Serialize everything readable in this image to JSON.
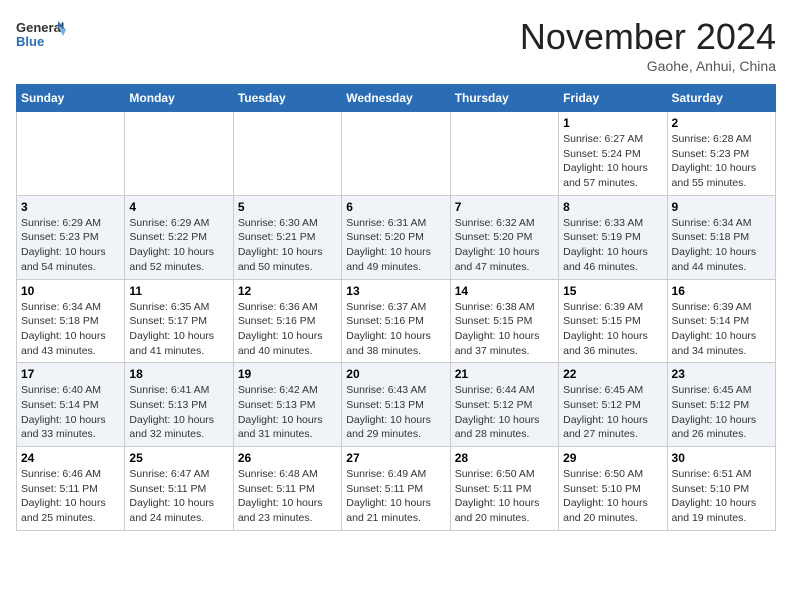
{
  "header": {
    "logo_line1": "General",
    "logo_line2": "Blue",
    "month_title": "November 2024",
    "location": "Gaohe, Anhui, China"
  },
  "weekdays": [
    "Sunday",
    "Monday",
    "Tuesday",
    "Wednesday",
    "Thursday",
    "Friday",
    "Saturday"
  ],
  "weeks": [
    [
      {
        "day": "",
        "info": ""
      },
      {
        "day": "",
        "info": ""
      },
      {
        "day": "",
        "info": ""
      },
      {
        "day": "",
        "info": ""
      },
      {
        "day": "",
        "info": ""
      },
      {
        "day": "1",
        "info": "Sunrise: 6:27 AM\nSunset: 5:24 PM\nDaylight: 10 hours and 57 minutes."
      },
      {
        "day": "2",
        "info": "Sunrise: 6:28 AM\nSunset: 5:23 PM\nDaylight: 10 hours and 55 minutes."
      }
    ],
    [
      {
        "day": "3",
        "info": "Sunrise: 6:29 AM\nSunset: 5:23 PM\nDaylight: 10 hours and 54 minutes."
      },
      {
        "day": "4",
        "info": "Sunrise: 6:29 AM\nSunset: 5:22 PM\nDaylight: 10 hours and 52 minutes."
      },
      {
        "day": "5",
        "info": "Sunrise: 6:30 AM\nSunset: 5:21 PM\nDaylight: 10 hours and 50 minutes."
      },
      {
        "day": "6",
        "info": "Sunrise: 6:31 AM\nSunset: 5:20 PM\nDaylight: 10 hours and 49 minutes."
      },
      {
        "day": "7",
        "info": "Sunrise: 6:32 AM\nSunset: 5:20 PM\nDaylight: 10 hours and 47 minutes."
      },
      {
        "day": "8",
        "info": "Sunrise: 6:33 AM\nSunset: 5:19 PM\nDaylight: 10 hours and 46 minutes."
      },
      {
        "day": "9",
        "info": "Sunrise: 6:34 AM\nSunset: 5:18 PM\nDaylight: 10 hours and 44 minutes."
      }
    ],
    [
      {
        "day": "10",
        "info": "Sunrise: 6:34 AM\nSunset: 5:18 PM\nDaylight: 10 hours and 43 minutes."
      },
      {
        "day": "11",
        "info": "Sunrise: 6:35 AM\nSunset: 5:17 PM\nDaylight: 10 hours and 41 minutes."
      },
      {
        "day": "12",
        "info": "Sunrise: 6:36 AM\nSunset: 5:16 PM\nDaylight: 10 hours and 40 minutes."
      },
      {
        "day": "13",
        "info": "Sunrise: 6:37 AM\nSunset: 5:16 PM\nDaylight: 10 hours and 38 minutes."
      },
      {
        "day": "14",
        "info": "Sunrise: 6:38 AM\nSunset: 5:15 PM\nDaylight: 10 hours and 37 minutes."
      },
      {
        "day": "15",
        "info": "Sunrise: 6:39 AM\nSunset: 5:15 PM\nDaylight: 10 hours and 36 minutes."
      },
      {
        "day": "16",
        "info": "Sunrise: 6:39 AM\nSunset: 5:14 PM\nDaylight: 10 hours and 34 minutes."
      }
    ],
    [
      {
        "day": "17",
        "info": "Sunrise: 6:40 AM\nSunset: 5:14 PM\nDaylight: 10 hours and 33 minutes."
      },
      {
        "day": "18",
        "info": "Sunrise: 6:41 AM\nSunset: 5:13 PM\nDaylight: 10 hours and 32 minutes."
      },
      {
        "day": "19",
        "info": "Sunrise: 6:42 AM\nSunset: 5:13 PM\nDaylight: 10 hours and 31 minutes."
      },
      {
        "day": "20",
        "info": "Sunrise: 6:43 AM\nSunset: 5:13 PM\nDaylight: 10 hours and 29 minutes."
      },
      {
        "day": "21",
        "info": "Sunrise: 6:44 AM\nSunset: 5:12 PM\nDaylight: 10 hours and 28 minutes."
      },
      {
        "day": "22",
        "info": "Sunrise: 6:45 AM\nSunset: 5:12 PM\nDaylight: 10 hours and 27 minutes."
      },
      {
        "day": "23",
        "info": "Sunrise: 6:45 AM\nSunset: 5:12 PM\nDaylight: 10 hours and 26 minutes."
      }
    ],
    [
      {
        "day": "24",
        "info": "Sunrise: 6:46 AM\nSunset: 5:11 PM\nDaylight: 10 hours and 25 minutes."
      },
      {
        "day": "25",
        "info": "Sunrise: 6:47 AM\nSunset: 5:11 PM\nDaylight: 10 hours and 24 minutes."
      },
      {
        "day": "26",
        "info": "Sunrise: 6:48 AM\nSunset: 5:11 PM\nDaylight: 10 hours and 23 minutes."
      },
      {
        "day": "27",
        "info": "Sunrise: 6:49 AM\nSunset: 5:11 PM\nDaylight: 10 hours and 21 minutes."
      },
      {
        "day": "28",
        "info": "Sunrise: 6:50 AM\nSunset: 5:11 PM\nDaylight: 10 hours and 20 minutes."
      },
      {
        "day": "29",
        "info": "Sunrise: 6:50 AM\nSunset: 5:10 PM\nDaylight: 10 hours and 20 minutes."
      },
      {
        "day": "30",
        "info": "Sunrise: 6:51 AM\nSunset: 5:10 PM\nDaylight: 10 hours and 19 minutes."
      }
    ]
  ]
}
